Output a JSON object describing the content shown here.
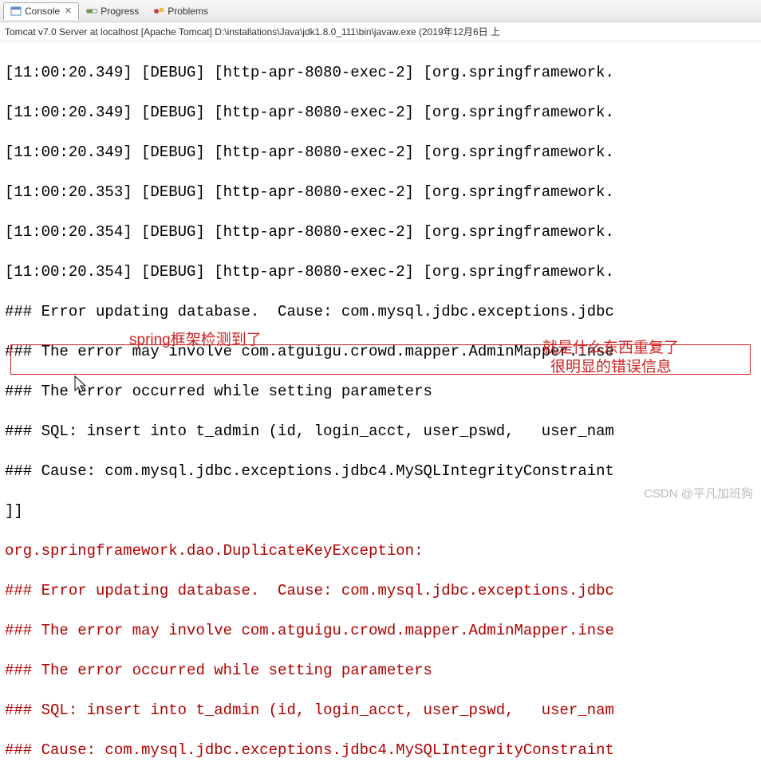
{
  "tabs": {
    "console": "Console",
    "progress": "Progress",
    "problems": "Problems"
  },
  "server_line": "Tomcat v7.0 Server at localhost [Apache Tomcat] D:\\installations\\Java\\jdk1.8.0_111\\bin\\javaw.exe (2019年12月6日 上",
  "log": {
    "l1": "[11:00:20.349] [DEBUG] [http-apr-8080-exec-2] [org.springframework.",
    "l2": "[11:00:20.349] [DEBUG] [http-apr-8080-exec-2] [org.springframework.",
    "l3": "[11:00:20.349] [DEBUG] [http-apr-8080-exec-2] [org.springframework.",
    "l4": "[11:00:20.353] [DEBUG] [http-apr-8080-exec-2] [org.springframework.",
    "l5": "[11:00:20.354] [DEBUG] [http-apr-8080-exec-2] [org.springframework.",
    "l6": "[11:00:20.354] [DEBUG] [http-apr-8080-exec-2] [org.springframework.",
    "l7": "### Error updating database.  Cause: com.mysql.jdbc.exceptions.jdbc",
    "l8": "### The error may involve com.atguigu.crowd.mapper.AdminMapper.inse",
    "l9": "### The error occurred while setting parameters",
    "l10": "### SQL: insert into t_admin (id, login_acct, user_pswd,   user_nam",
    "l11": "### Cause: com.mysql.jdbc.exceptions.jdbc4.MySQLIntegrityConstraint",
    "l12": "]]",
    "l13": "org.springframework.dao.DuplicateKeyException: ",
    "l14": "### Error updating database.  Cause: com.mysql.jdbc.exceptions.jdbc",
    "l15": "### The error may involve com.atguigu.crowd.mapper.AdminMapper.inse",
    "l16": "### The error occurred while setting parameters",
    "l17": "### SQL: insert into t_admin (id, login_acct, user_pswd,   user_nam",
    "l18": "### Cause: com.mysql.jdbc.exceptions.jdbc4.MySQLIntegrityConstraint"
  },
  "annotations": {
    "a1": "spring框架检测到了",
    "a2": "就是什么东西重复了",
    "a3": "很明显的错误信息"
  },
  "watermark": "CSDN @平凡加班狗"
}
